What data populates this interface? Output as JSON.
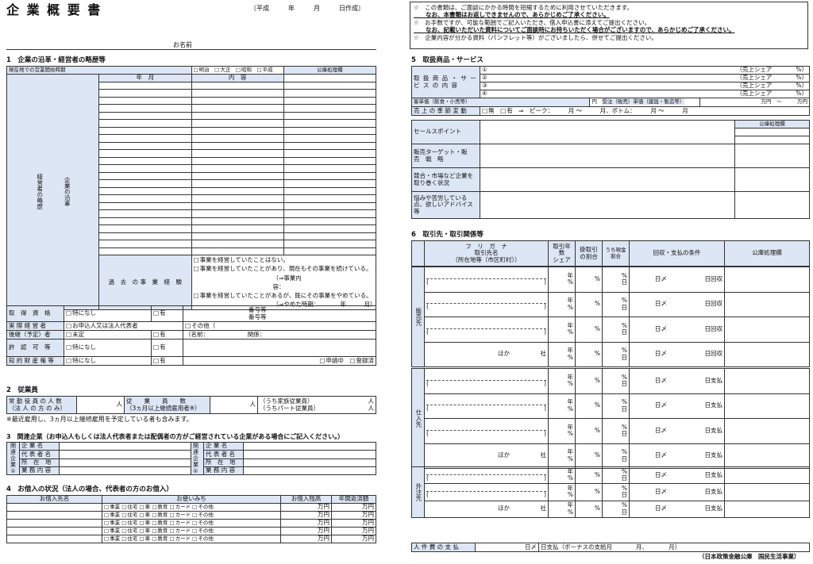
{
  "title": "企 業 概 要 書",
  "date_line": "〔平成　　　年　　　月　　　日作成〕",
  "name_label": "お名前",
  "notices": [
    "☆　この書類は、ご面談にかかる時間を短縮するために利用させていただきます。",
    "　　なお、本書類はお返しできませんので、あらかじめご了承ください。",
    "☆　お手数ですが、可能な範囲でご記入いただき、借入申込書に添えてご提出ください。",
    "　　なお、記載いただいた資料についてご面談時にお持ちいただく場合がございますので、あらかじめご了承ください。",
    "☆　企業内容が分かる資料（パンフレット等）がございましたら、併せてご提出ください。"
  ],
  "s1": {
    "title": "1　企業の沿革・経営者の略歴等",
    "start_label": "現在地での営業開始時期",
    "eras": [
      "明治",
      "大正",
      "昭和",
      "平成"
    ],
    "year": "年",
    "month": "月",
    "office": "公庫処理欄",
    "col_ym": "年　月",
    "col_content": "内　容",
    "side1": "企業の沿革",
    "side2": "経営者の略歴",
    "past_label": "過　去　の 事　業　経　験",
    "past1": "事業を経営していたことはない。",
    "past2": "事業を経営していたことがあり、現在もその事業を続けている。",
    "past2b": "（⇒事業内容：　　　　　　　　　　　　　　　　）",
    "past3": "事業を経営していたことがあるが、既にその事業をやめている。",
    "past3b": "（⇒やめた時期：　　　　年　　　月）",
    "qual_label": "取　得　資　格",
    "none": "特になし",
    "have": "有",
    "num": "番号等",
    "biz_mgr": "実 際 経 営 者",
    "biz_mgr_opt1": "お申込人又は法人代表者",
    "biz_mgr_opt2": "その他（",
    "succ": "後継（予定）者",
    "undecided": "未定",
    "succ_name": "（名前：",
    "succ_rel": "関係：",
    "perm": "許　認　可　等",
    "ip": "知 的 財 産 権 等",
    "ip_apply": "申請中",
    "ip_reg": "登録済"
  },
  "s2": {
    "title": "2　従業員",
    "l1": "常 勤 役 員 の 人 数",
    "l1b": "（法 人 の 方 の み）",
    "person": "人",
    "l2": "従　　業　　員　　数",
    "l2b": "（3ヵ月以上継続雇用者※）",
    "fam": "（うち家族従業員）",
    "part": "（うちパート従業員）",
    "note": "※最近雇用し、3ヵ月以上継続雇用を予定している者も含みます。"
  },
  "s3": {
    "title": "3　関連企業（お申込人もしくは法人代表者または配偶者の方がご経営されている企業がある場合にご記入ください。）",
    "side1": "関連企業①",
    "side2": "関連企業②",
    "rows": [
      "企 業 名",
      "代 表 者 名",
      "所　在　地",
      "業 務 内 容"
    ]
  },
  "s4": {
    "title": "4　お借入の状況（法人の場合、代表者の方のお借入）",
    "h1": "お借入先名",
    "h2": "お使いみち",
    "h3": "お借入残高",
    "h4": "年間返済額",
    "uses": [
      "事業",
      "住宅",
      "車",
      "教育",
      "カード",
      "その他"
    ],
    "unit": "万円"
  },
  "s5": {
    "title": "5　取扱商品・サービス",
    "label": "取 扱 商 品 ・ サ ー ビ ス の 内 容",
    "items": [
      "①",
      "②",
      "③",
      "④"
    ],
    "share": "（売上シェア　　　　%）",
    "unit_price1": "客単価（飲食・小売等）",
    "yen": "円",
    "unit_price2": "受注（販売）単価（建設・製造等）",
    "man": "万円　～",
    "man2": "万円",
    "season": "売 上 の 季 節 変 動",
    "none": "無",
    "have": "有",
    "peak": "⇒　ピーク：　　　月 ～　　　月、ボトム：　　　月 ～　　　月",
    "office": "公庫処理欄",
    "sales_point": "セールスポイント",
    "target": "販売ターゲット・販　売　戦　略",
    "compet": "競合・市場など企業を取り巻く状況",
    "advice": "悩みや苦労している点、欲しいアドバイス等"
  },
  "s6": {
    "title": "6　取引先・取引関係等",
    "furi": "フ　リ　ガ　ナ",
    "name": "取引先名",
    "addr": "（所在地等（市区町村））",
    "c_ratio": "取引年数",
    "c_share": "シェア",
    "c_cash": "掛取引の割合",
    "c_cond": "うち現金割合",
    "c_terms": "回収・支払の条件",
    "c_office": "公庫処理欄",
    "sides": [
      "販売先",
      "仕入先",
      "外注先"
    ],
    "other": "ほか",
    "co": "社",
    "nen": "年",
    "pct": "%",
    "day": "日",
    "shime": "日〆",
    "kaishu": "日回収",
    "shiharai": "日支払"
  },
  "labor": "人 件 費 の 支 払",
  "labor2": "日〆",
  "labor3": "日支払（ボーナスの支給月　　　　月、　　　　月）",
  "footer": "（日本政策金融公庫　国民生活事業）"
}
